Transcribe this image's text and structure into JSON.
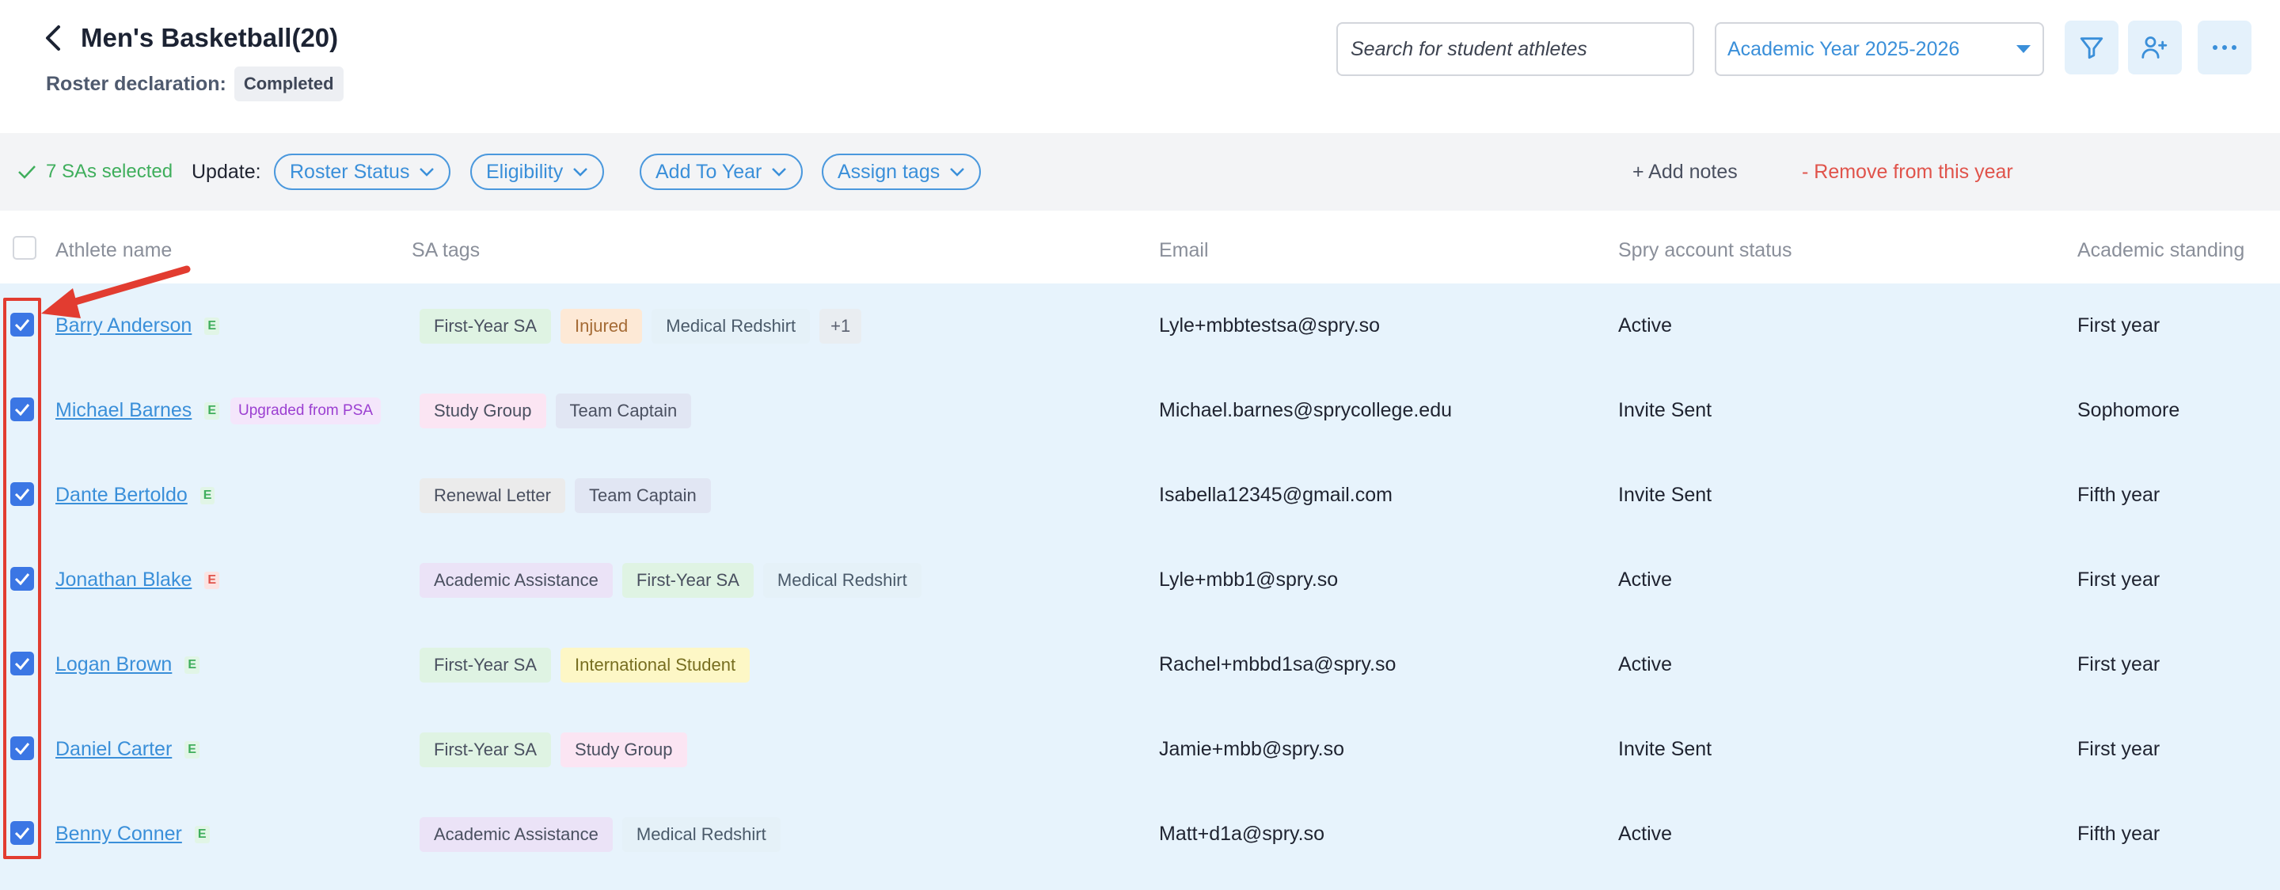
{
  "header": {
    "title": "Men's Basketball(20)",
    "roster_label": "Roster declaration:",
    "roster_status": "Completed",
    "search_placeholder": "Search for student athletes",
    "year": "Academic Year 2025-2026"
  },
  "colors": {
    "accent": "#3a8fd9",
    "checkbox": "#3b76e4",
    "selected_row_bg": "#e7f3fc",
    "success": "#3fae5c",
    "danger": "#e0534b",
    "annotation": "#e23c30"
  },
  "icons": [
    "back-chevron-icon",
    "dropdown-caret-icon",
    "filter-icon",
    "add-user-icon",
    "more-dots-icon",
    "check-icon",
    "chevron-down-icon"
  ],
  "action_bar": {
    "selected": "7 SAs selected",
    "update_label": "Update:",
    "buttons": [
      "Roster Status",
      "Eligibility",
      "Add To Year",
      "Assign tags"
    ],
    "add_notes": "+ Add notes",
    "remove": "- Remove from this year"
  },
  "table": {
    "columns": [
      "Athlete name",
      "SA tags",
      "Email",
      "Spry account status",
      "Academic standing"
    ],
    "rows": [
      {
        "name": "Barry Anderson",
        "elig": "E",
        "tags": [
          "First-Year SA",
          "Injured",
          "Medical Redshirt",
          "+1"
        ],
        "email": "Lyle+mbbtestsa@spry.so",
        "status": "Active",
        "standing": "First year"
      },
      {
        "name": "Michael Barnes",
        "elig": "E",
        "badge": "Upgraded from PSA",
        "tags": [
          "Study Group",
          "Team Captain"
        ],
        "email": "Michael.barnes@sprycollege.edu",
        "status": "Invite Sent",
        "standing": "Sophomore"
      },
      {
        "name": "Dante Bertoldo",
        "elig": "E",
        "tags": [
          "Renewal Letter",
          "Team Captain"
        ],
        "email": "Isabella12345@gmail.com",
        "status": "Invite Sent",
        "standing": "Fifth year"
      },
      {
        "name": "Jonathan Blake",
        "elig": "E",
        "tags": [
          "Academic Assistance",
          "First-Year SA",
          "Medical Redshirt"
        ],
        "email": "Lyle+mbb1@spry.so",
        "status": "Active",
        "standing": "First year"
      },
      {
        "name": "Logan Brown",
        "elig": "E",
        "tags": [
          "First-Year SA",
          "International Student"
        ],
        "email": "Rachel+mbbd1sa@spry.so",
        "status": "Active",
        "standing": "First year"
      },
      {
        "name": "Daniel Carter",
        "elig": "E",
        "tags": [
          "First-Year SA",
          "Study Group"
        ],
        "email": "Jamie+mbb@spry.so",
        "status": "Invite Sent",
        "standing": "First year"
      },
      {
        "name": "Benny Conner",
        "elig": "E",
        "tags": [
          "Academic Assistance",
          "Medical Redshirt"
        ],
        "email": "Matt+d1a@spry.so",
        "status": "Active",
        "standing": "Fifth year"
      }
    ]
  }
}
